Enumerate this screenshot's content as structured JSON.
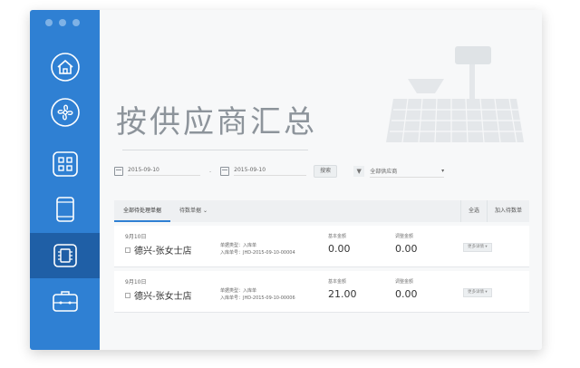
{
  "sidebar": {
    "items": [
      {
        "icon": "home-icon"
      },
      {
        "icon": "fan-icon"
      },
      {
        "icon": "grid-icon"
      },
      {
        "icon": "tablet-icon"
      },
      {
        "icon": "chip-icon",
        "active": true
      },
      {
        "icon": "toolbox-icon"
      }
    ],
    "colors": {
      "bg": "#2f80d3",
      "active": "#1f5fa6"
    }
  },
  "page": {
    "title": "按供应商汇总"
  },
  "filters": {
    "date_from": "2015-09-10",
    "date_sep": "-",
    "date_to": "2015-09-10",
    "search_label": "搜索",
    "filter_icon": "funnel-icon",
    "supplier_select": "全部供应商"
  },
  "tabs": {
    "items": [
      "全部待处理单据",
      "待数单据"
    ],
    "right_buttons": [
      "全选",
      "加入待数单"
    ]
  },
  "records": [
    {
      "date": "9月10日",
      "store": "德兴-张女士店",
      "doc_type": "单据类型：入库单",
      "doc_no": "入库单号：JHD-2015-09-10-00004",
      "base_label": "基本金额",
      "base_value": "0.00",
      "adjust_label": "调整金额",
      "adjust_value": "0.00",
      "action": "更多详情"
    },
    {
      "date": "9月10日",
      "store": "德兴-张女士店",
      "doc_type": "单据类型：入库单",
      "doc_no": "入库单号：JHD-2015-09-10-00006",
      "base_label": "基本金额",
      "base_value": "21.00",
      "adjust_label": "调整金额",
      "adjust_value": "0.00",
      "action": "更多详情"
    }
  ]
}
